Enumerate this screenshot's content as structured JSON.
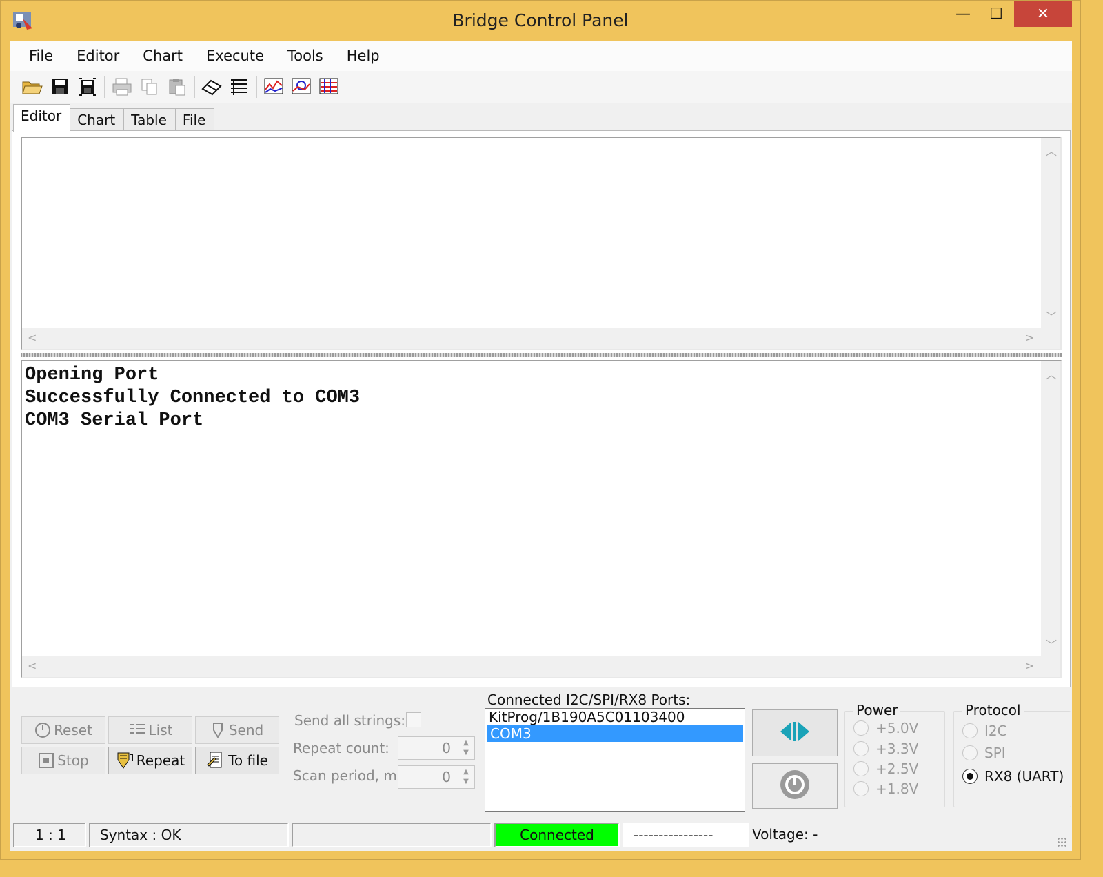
{
  "window": {
    "title": "Bridge Control Panel",
    "controls": {
      "minimize": "—",
      "maximize": "☐",
      "close": "✕"
    }
  },
  "menu": [
    "File",
    "Editor",
    "Chart",
    "Execute",
    "Tools",
    "Help"
  ],
  "toolbar_icons": [
    "open-folder-icon",
    "save-icon",
    "save-all-icon",
    "print-icon",
    "copy-icon",
    "paste-icon",
    "eraser-icon",
    "list-icon",
    "chart-line-icon",
    "chart-zoom-icon",
    "chart-table-icon"
  ],
  "tabs": [
    "Editor",
    "Chart",
    "Table",
    "File"
  ],
  "log": {
    "lines": [
      "Opening Port",
      "Successfully Connected to COM3",
      "COM3 Serial Port"
    ]
  },
  "buttons": {
    "reset": "Reset",
    "list": "List",
    "send": "Send",
    "stop": "Stop",
    "repeat": "Repeat",
    "to_file": "To file"
  },
  "options": {
    "send_all_label": "Send all strings:",
    "repeat_count_label": "Repeat count:",
    "repeat_count_value": "0",
    "scan_period_label": "Scan period, ms:",
    "scan_period_value": "0"
  },
  "ports": {
    "label": "Connected I2C/SPI/RX8 Ports:",
    "items": [
      "KitProg/1B190A5C01103400",
      "COM3"
    ],
    "selected": "COM3"
  },
  "power": {
    "title": "Power",
    "options": [
      "+5.0V",
      "+3.3V",
      "+2.5V",
      "+1.8V"
    ]
  },
  "protocol": {
    "title": "Protocol",
    "options": [
      "I2C",
      "SPI",
      "RX8 (UART)"
    ],
    "selected": "RX8 (UART)"
  },
  "status": {
    "position": "1 : 1",
    "syntax": "Syntax : OK",
    "empty": "",
    "connection": "Connected",
    "dashes": "----------------",
    "voltage": "Voltage: -"
  },
  "colors": {
    "titlebar": "#f0c45c",
    "close_button": "#c7453a",
    "selection": "#3399ff",
    "connected": "#00ff00",
    "accent_teal": "#1aa3b8"
  }
}
